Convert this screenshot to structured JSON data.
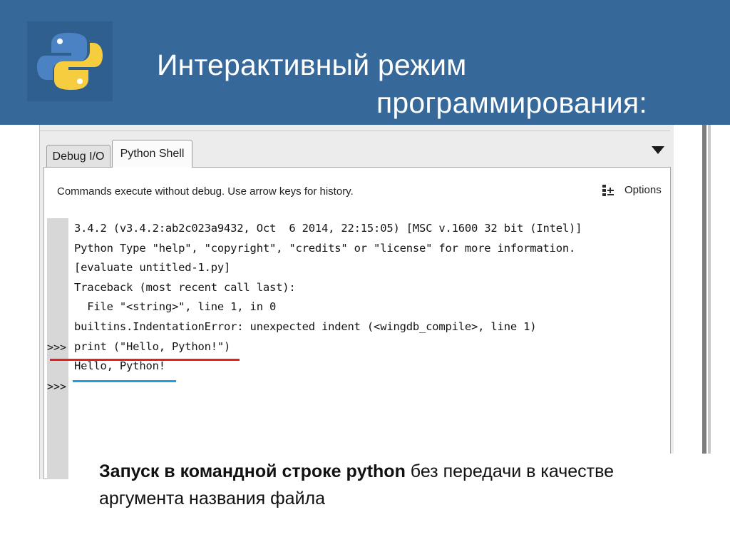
{
  "slide": {
    "title_line1": "Интерактивный режим",
    "title_line2": "программирования:",
    "logo_icon": "python-logo-icon",
    "header_color": "#36689a"
  },
  "ide": {
    "tabs": [
      {
        "label": "Debug I/O",
        "active": false
      },
      {
        "label": "Python Shell",
        "active": true
      }
    ],
    "tab_menu_icon": "triangle-down-icon",
    "info_text": "Commands execute without debug.  Use arrow keys for history.",
    "options_label": "Options",
    "options_icon": "options-list-icon",
    "console_lines": [
      {
        "prompt": "",
        "text": "3.4.2 (v3.4.2:ab2c023a9432, Oct  6 2014, 22:15:05) [MSC v.1600 32 bit (Intel)]"
      },
      {
        "prompt": "",
        "text": "Python Type \"help\", \"copyright\", \"credits\" or \"license\" for more information."
      },
      {
        "prompt": "",
        "text": "[evaluate untitled-1.py]"
      },
      {
        "prompt": "",
        "text": "Traceback (most recent call last):"
      },
      {
        "prompt": "",
        "text": "  File \"<string>\", line 1, in 0"
      },
      {
        "prompt": "",
        "text": "builtins.IndentationError: unexpected indent (<wingdb_compile>, line 1)"
      },
      {
        "prompt": ">>>",
        "text": "print (\"Hello, Python!\")"
      },
      {
        "prompt": "",
        "text": "Hello, Python!"
      },
      {
        "prompt": ">>>",
        "text": ""
      }
    ],
    "highlight_colors": {
      "command_underline": "#e81f1f",
      "output_underline": "#1aa1de"
    }
  },
  "caption": {
    "bold_part": "Запуск в командной строке python",
    "rest_part": " без передачи в качестве",
    "line2": "аргумента названия файла"
  }
}
